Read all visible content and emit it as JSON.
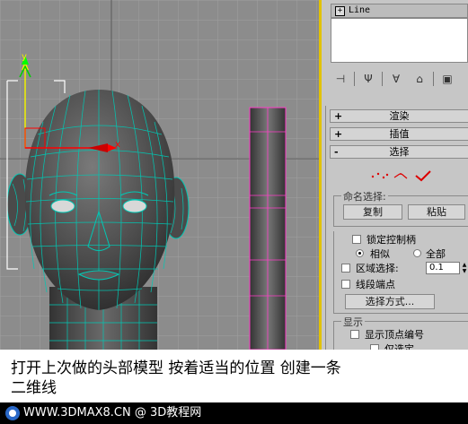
{
  "viewport": {
    "axis_labels": {
      "x": "x",
      "y": "y"
    }
  },
  "panel": {
    "object_title": "Line",
    "object_title_icon": "plus-box-icon",
    "toolbar_icons": [
      "pin-icon",
      "fork-icon",
      "funnel-icon",
      "trash-icon",
      "modifier-icon"
    ],
    "rollouts": [
      {
        "sign": "+",
        "label": "渲染"
      },
      {
        "sign": "+",
        "label": "插值"
      },
      {
        "sign": "-",
        "label": "选择"
      }
    ],
    "selection_icons": [
      "vertex-icon",
      "segment-icon",
      "spline-icon"
    ],
    "named_selection": {
      "title": "命名选择:",
      "copy_button": "复制",
      "paste_button": "粘贴"
    },
    "handles": {
      "lock_handles_label": "锁定控制柄",
      "similar_label": "相似",
      "all_label": "全部",
      "area_select_label": "区域选择:",
      "area_select_value": "0.1",
      "segment_end_label": "线段端点",
      "select_by_button": "选择方式..."
    },
    "display": {
      "title": "显示",
      "show_vertex_numbers": "显示顶点编号",
      "selected_only": "仅选定"
    }
  },
  "caption": {
    "line1": "打开上次做的头部模型 按着适当的位置  创建一条",
    "line2": "二维线"
  },
  "footer": {
    "text": "WWW.3DMAX8.CN @ 3D教程网"
  },
  "colors": {
    "viewport_bg": "#8c8c8c",
    "mesh_wire": "#00c8b4",
    "spline_pink": "#ff3cc8",
    "viewport_border": "#e2c200"
  }
}
